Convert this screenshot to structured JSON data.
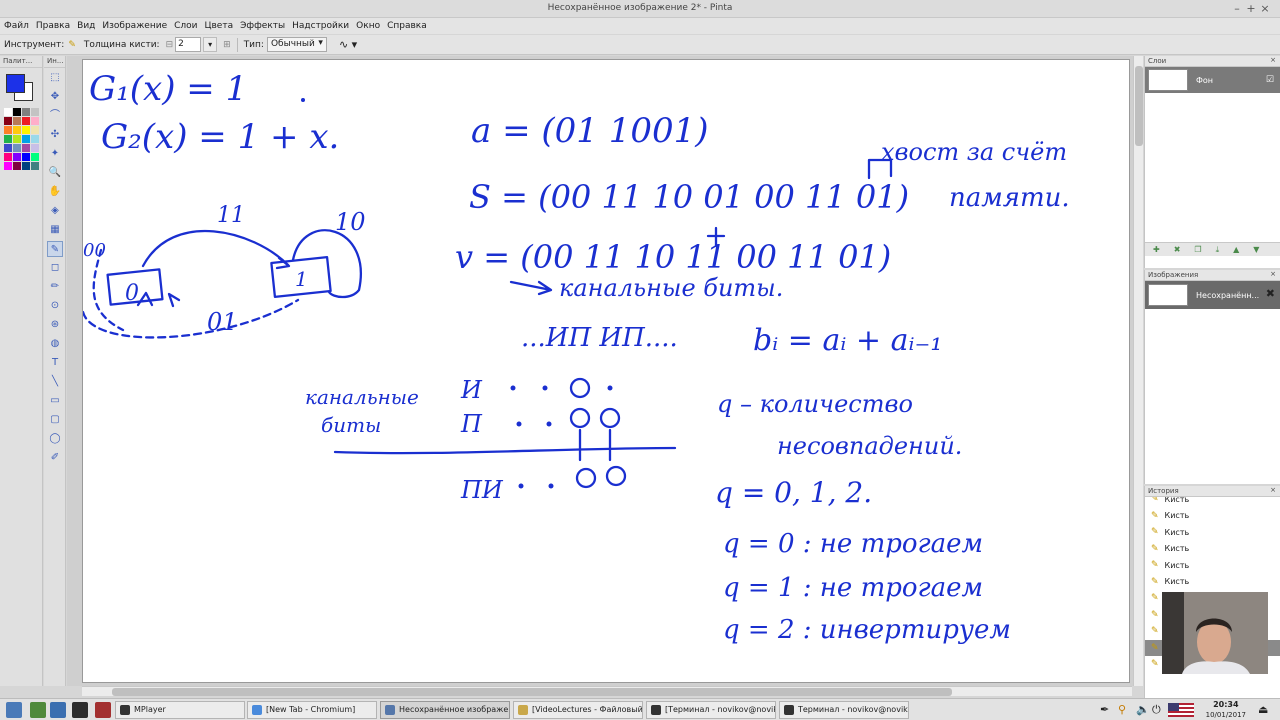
{
  "window": {
    "title": "Несохранённое изображение 2* - Pinta",
    "controls": [
      "–",
      "+",
      "×"
    ]
  },
  "menu": [
    "Файл",
    "Правка",
    "Вид",
    "Изображение",
    "Слои",
    "Цвета",
    "Эффекты",
    "Надстройки",
    "Окно",
    "Справка"
  ],
  "toolbar": {
    "tool_label": "Инструмент:",
    "brush_width_label": "Толщина кисти:",
    "brush_width_value": "2",
    "type_label": "Тип:",
    "type_value": "Обычный"
  },
  "palette": {
    "header": "Палит...",
    "primary_color": "#1c31e8",
    "secondary_color": "#ffffff",
    "swatches": [
      "#ffffff",
      "#000000",
      "#7f7f7f",
      "#c3c3c3",
      "#880015",
      "#b97a57",
      "#ed1c24",
      "#ffaec9",
      "#ff7f27",
      "#ffc90e",
      "#fff200",
      "#efe4b0",
      "#22b14c",
      "#b5e61d",
      "#00a2e8",
      "#99d9ea",
      "#3f48cc",
      "#7092be",
      "#a349a4",
      "#c8bfe7",
      "#ff0080",
      "#8000ff",
      "#0000ff",
      "#00ff80",
      "#ff00ff",
      "#800040",
      "#004080",
      "#408080"
    ]
  },
  "tools": {
    "header": "Ин...",
    "items": [
      "select-rect-icon",
      "move-icon",
      "lasso-icon",
      "move-selection-icon",
      "magic-wand-icon",
      "zoom-icon",
      "pan-icon",
      "paint-bucket-icon",
      "gradient-icon",
      "brush-icon",
      "eraser-icon",
      "pencil-icon",
      "color-picker-icon",
      "clone-stamp-icon",
      "recolor-icon",
      "text-icon",
      "line-icon",
      "rectangle-icon",
      "rounded-rect-icon",
      "ellipse-icon",
      "freeform-icon"
    ],
    "active_index": 9
  },
  "canvas": {
    "ink_color": "#1a2fd0",
    "notes": {
      "g1": "G₁(x) = 1",
      "g2": "G₂(x) = 1 + x.",
      "a": "a = (01 1001)",
      "tail": "хвост за счёт",
      "s": "S = (00 11 10 01 00 11 01)",
      "memory": "памяти.",
      "v": "v = (00 11 10 11 00 11 01)",
      "channel_bits": "канальные биты.",
      "ip": "...ИП ИП....",
      "bi": "bᵢ = aᵢ + aᵢ₋₁",
      "label_channel": "канальные",
      "label_bits": "биты",
      "row1": "И",
      "row2": "П",
      "row3": "ПИ",
      "q_def1": "q – количество",
      "q_def2": "несовпадений.",
      "q_vals": "q = 0, 1, 2.",
      "q0": "q = 0 : не трогаем",
      "q1": "q = 1 : не трогаем",
      "q2": "q = 2 : инвертируем",
      "state0": "0",
      "state1": "1",
      "edge11": "11",
      "edge10": "10",
      "edge00": "00",
      "edge01": "01"
    }
  },
  "layers": {
    "header": "Слои",
    "items": [
      {
        "name": "Фон"
      }
    ]
  },
  "images": {
    "header": "Изображения",
    "items": [
      {
        "name": "Несохранённ..."
      }
    ]
  },
  "history": {
    "header": "История",
    "items": [
      "Кисть",
      "Кисть",
      "Кисть",
      "Кисть",
      "Кисть",
      "Кисть",
      "Кисть",
      "Кисть",
      "Кисть",
      "Кисть",
      "Кисть"
    ]
  },
  "taskbar": {
    "tasks": [
      {
        "label": "MPlayer",
        "color": "#333333"
      },
      {
        "label": "[New Tab - Chromium]",
        "color": "#4a8bdc"
      },
      {
        "label": "Несохранённое изображе...",
        "color": "#5577aa"
      },
      {
        "label": "[VideoLectures - Файловый ...",
        "color": "#c9a84b"
      },
      {
        "label": "[Терминал - novikov@novik...",
        "color": "#333333"
      },
      {
        "label": "Терминал - novikov@noviko...",
        "color": "#333333"
      }
    ],
    "time": "20:34",
    "date": "10/01/2017"
  }
}
